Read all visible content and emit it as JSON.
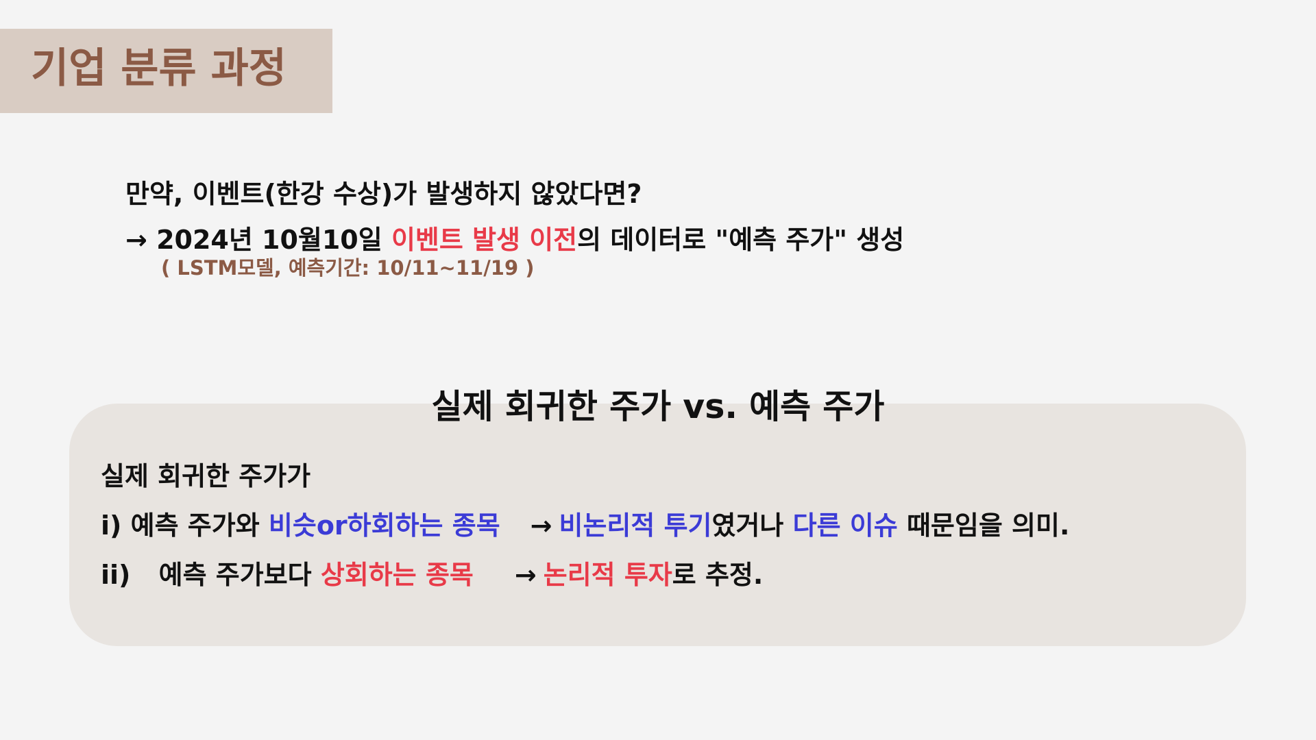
{
  "header": {
    "title": "기업 분류 과정"
  },
  "intro": {
    "question": "만약, 이벤트(한강 수상)가 발생하지 않았다면?",
    "arrow": "→",
    "line2_prefix": "2024년 10월10일 ",
    "line2_highlight": "이벤트 발생 이전",
    "line2_suffix": "의 데이터로 \"예측 주가\" 생성",
    "line3": "( LSTM모델, 예측기간: 10/11~11/19 )"
  },
  "panel": {
    "title": "실제 회귀한 주가 vs. 예측 주가",
    "lead": "실제 회귀한 주가가",
    "item1": {
      "marker": "i)",
      "text1": "예측 주가와 ",
      "highlight1": "비슷or하회하는 종목",
      "arrow": "→",
      "highlight2": "비논리적 투기",
      "text2": "였거나 ",
      "highlight3": "다른 이슈",
      "text3": " 때문임을 의미."
    },
    "item2": {
      "marker": "ii)",
      "text1": "예측 주가보다 ",
      "highlight1": "상회하는 종목",
      "arrow": "→",
      "highlight2": "논리적 투자",
      "text2": "로 추정."
    }
  },
  "colors": {
    "background": "#f4f4f4",
    "title_box": "#d9ccc3",
    "title_text": "#8b5a45",
    "panel": "#e8e4e0",
    "red": "#e83a48",
    "blue": "#3b3bd6",
    "text": "#111111"
  }
}
